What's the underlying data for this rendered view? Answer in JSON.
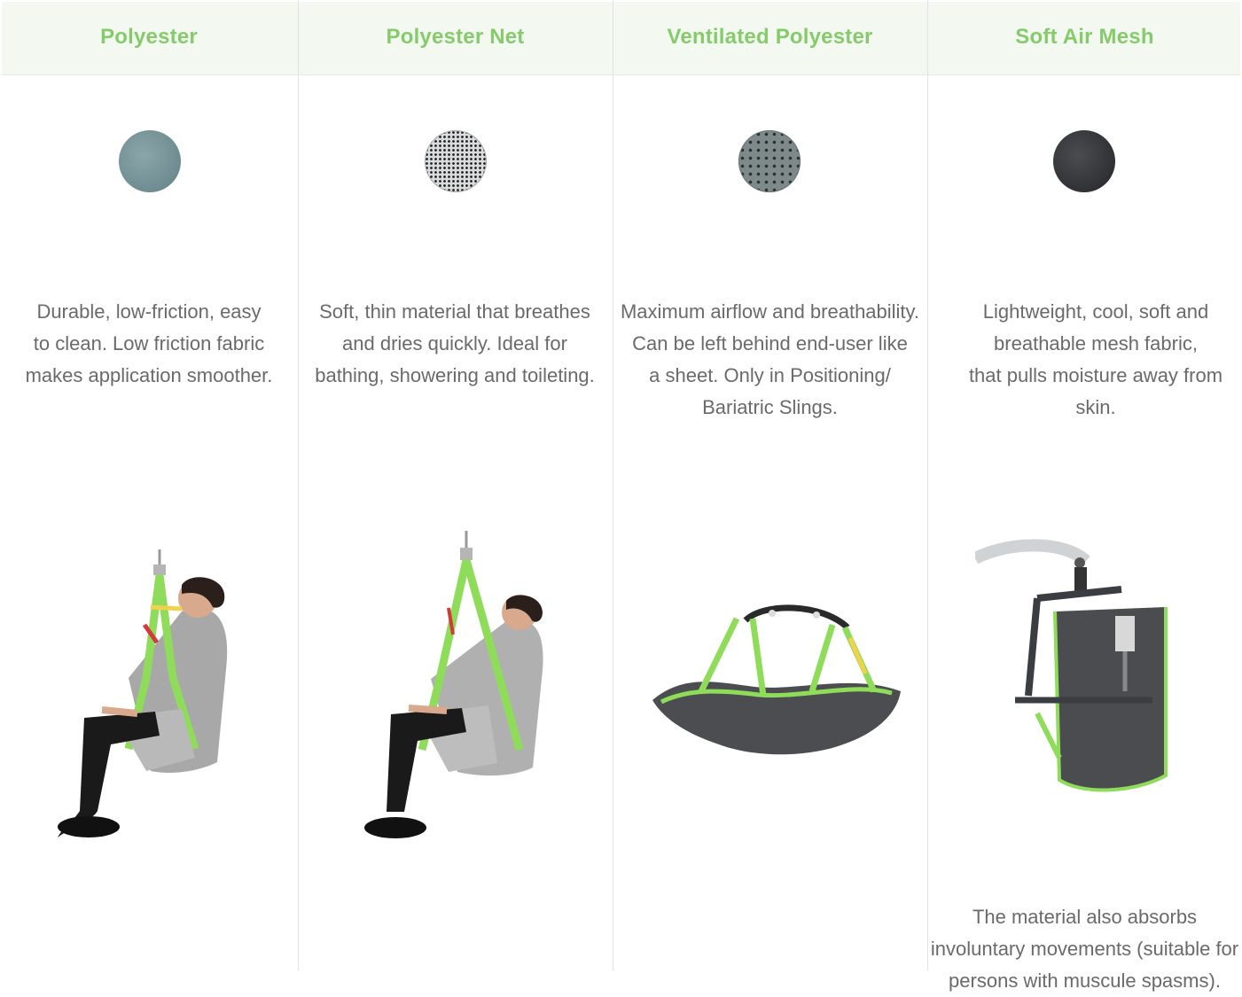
{
  "columns": [
    {
      "title": "Polyester",
      "desc_lines": [
        "Durable, low-friction, easy",
        "to clean. Low friction fabric",
        "makes application smoother."
      ]
    },
    {
      "title": "Polyester Net",
      "desc_lines": [
        "Soft, thin material that breathes",
        "and dries quickly. Ideal for",
        "bathing, showering and toileting."
      ]
    },
    {
      "title": "Ventilated Polyester",
      "desc_lines": [
        "Maximum airflow and breathability.",
        "Can be left behind end-user like",
        "a sheet. Only in Positioning/",
        "Bariatric Slings."
      ]
    },
    {
      "title": "Soft Air Mesh",
      "desc_lines": [
        "Lightweight, cool, soft and",
        "breathable mesh fabric,",
        "that pulls moisture away from",
        "skin."
      ],
      "extra_lines": [
        "The material also absorbs",
        "involuntary movements (suitable for",
        "persons with muscule spasms)."
      ]
    }
  ],
  "colors": {
    "title_green": "#86cb6b",
    "header_bg": "#f3f9f1",
    "sling_green": "#8fdc5a"
  }
}
